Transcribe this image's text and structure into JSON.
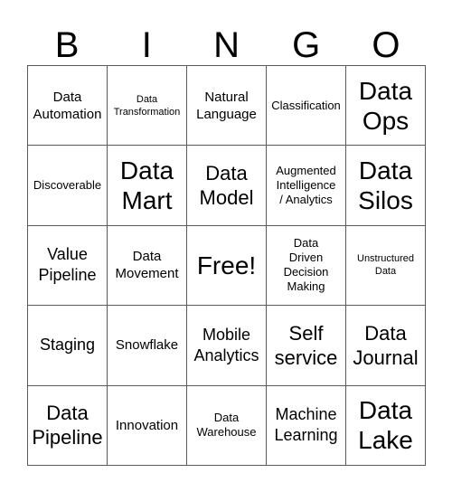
{
  "card": {
    "title_letters": [
      "B",
      "I",
      "N",
      "G",
      "O"
    ],
    "columns": 5,
    "rows": 5,
    "free_space_label": "Free!",
    "border_color": "#5a5a5a",
    "text_color": "#000000",
    "background_color": "#ffffff",
    "cells": [
      [
        {
          "label": "Data\nAutomation",
          "size": "m"
        },
        {
          "label": "Data\nTransformation",
          "size": "xs"
        },
        {
          "label": "Natural\nLanguage",
          "size": "m"
        },
        {
          "label": "Classification",
          "size": "s"
        },
        {
          "label": "Data\nOps",
          "size": "xxl"
        }
      ],
      [
        {
          "label": "Discoverable",
          "size": "s"
        },
        {
          "label": "Data\nMart",
          "size": "xxl"
        },
        {
          "label": "Data\nModel",
          "size": "xl"
        },
        {
          "label": "Augmented\nIntelligence\n/ Analytics",
          "size": "s"
        },
        {
          "label": "Data\nSilos",
          "size": "xxl"
        }
      ],
      [
        {
          "label": "Value\nPipeline",
          "size": "l"
        },
        {
          "label": "Data\nMovement",
          "size": "m"
        },
        {
          "label": "Free!",
          "size": "xxl"
        },
        {
          "label": "Data\nDriven\nDecision\nMaking",
          "size": "s"
        },
        {
          "label": "Unstructured\nData",
          "size": "xs"
        }
      ],
      [
        {
          "label": "Staging",
          "size": "l"
        },
        {
          "label": "Snowflake",
          "size": "m"
        },
        {
          "label": "Mobile\nAnalytics",
          "size": "l"
        },
        {
          "label": "Self\nservice",
          "size": "xl"
        },
        {
          "label": "Data\nJournal",
          "size": "xl"
        }
      ],
      [
        {
          "label": "Data\nPipeline",
          "size": "xl"
        },
        {
          "label": "Innovation",
          "size": "m"
        },
        {
          "label": "Data\nWarehouse",
          "size": "s"
        },
        {
          "label": "Machine\nLearning",
          "size": "l"
        },
        {
          "label": "Data\nLake",
          "size": "xxl"
        }
      ]
    ]
  }
}
